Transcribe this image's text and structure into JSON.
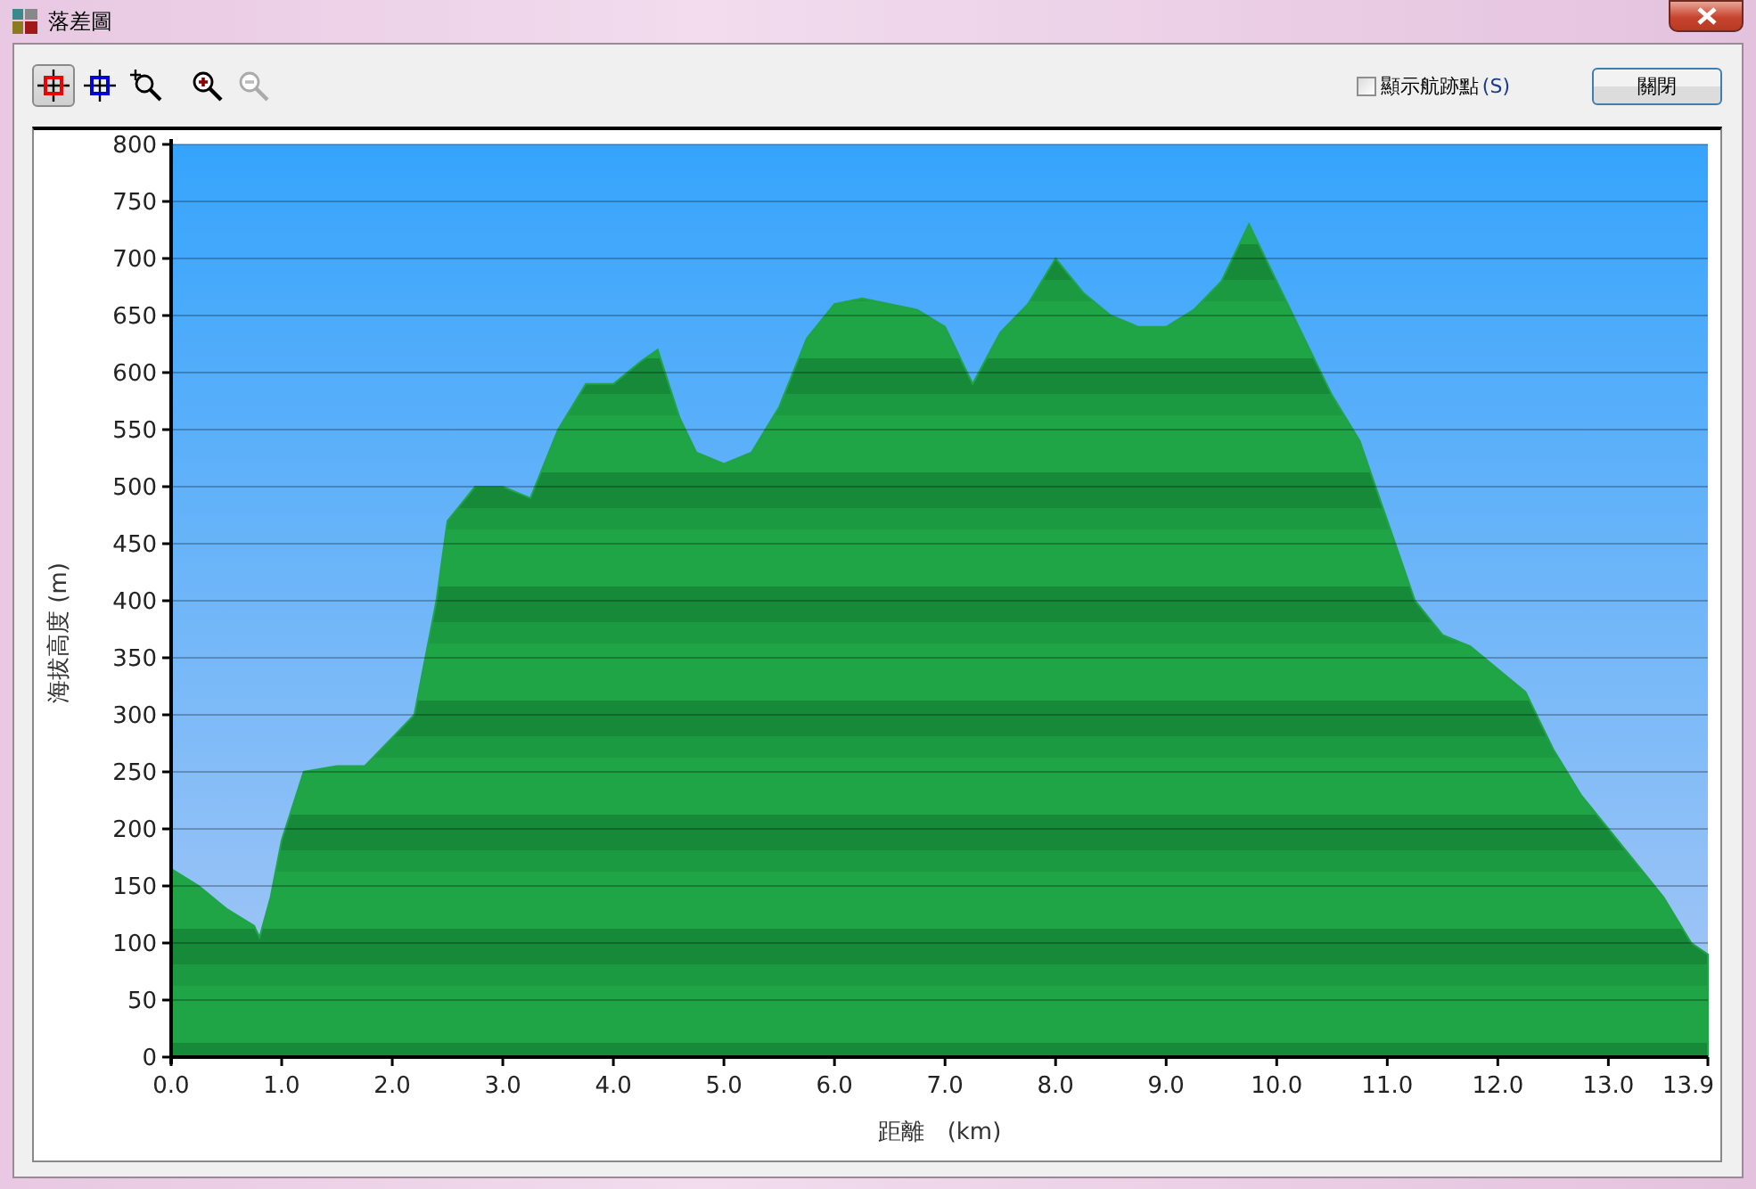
{
  "window": {
    "title": "落差圖"
  },
  "toolbar": {
    "tools": [
      {
        "kind": "marker",
        "selected": true,
        "disabled": false
      },
      {
        "kind": "point",
        "selected": false,
        "disabled": false
      },
      {
        "kind": "zoom-box",
        "selected": false,
        "disabled": false
      },
      {
        "kind": "zoom-in",
        "selected": false,
        "disabled": false
      },
      {
        "kind": "zoom-out",
        "selected": false,
        "disabled": true
      }
    ],
    "show_points": {
      "label": "顯示航跡點",
      "accel": "(S)",
      "checked": false
    },
    "close_button": "關閉"
  },
  "chart": {
    "chart_data": {
      "type": "area",
      "xlabel": "距離　(km)",
      "ylabel": "海拔高度 (m)",
      "x": [
        0,
        0.25,
        0.5,
        0.75,
        0.8,
        0.9,
        1.0,
        1.2,
        1.5,
        1.75,
        2.0,
        2.2,
        2.4,
        2.5,
        2.75,
        3.0,
        3.25,
        3.5,
        3.75,
        4.0,
        4.25,
        4.4,
        4.6,
        4.75,
        5.0,
        5.25,
        5.5,
        5.75,
        6.0,
        6.25,
        6.5,
        6.75,
        7.0,
        7.25,
        7.5,
        7.75,
        8.0,
        8.25,
        8.5,
        8.75,
        9.0,
        9.25,
        9.5,
        9.75,
        10.0,
        10.25,
        10.5,
        10.75,
        11.0,
        11.25,
        11.5,
        11.75,
        12.0,
        12.25,
        12.5,
        12.75,
        13.0,
        13.25,
        13.5,
        13.75,
        13.9
      ],
      "grid": true,
      "series": [
        {
          "color": "#1fa446",
          "values": [
            165,
            150,
            130,
            115,
            105,
            140,
            190,
            250,
            255,
            255,
            280,
            300,
            400,
            470,
            500,
            500,
            490,
            550,
            590,
            590,
            610,
            620,
            560,
            530,
            520,
            530,
            570,
            630,
            660,
            665,
            660,
            655,
            640,
            590,
            635,
            660,
            700,
            670,
            650,
            640,
            640,
            655,
            680,
            730,
            680,
            630,
            580,
            540,
            470,
            400,
            370,
            360,
            340,
            320,
            270,
            230,
            200,
            170,
            140,
            100,
            90
          ]
        }
      ],
      "xlim": [
        0,
        13.9
      ],
      "ylim": [
        0,
        800
      ],
      "xticks": [
        {
          "value": 0,
          "label": "0.0"
        },
        {
          "value": 1,
          "label": "1.0"
        },
        {
          "value": 2,
          "label": "2.0"
        },
        {
          "value": 3,
          "label": "3.0"
        },
        {
          "value": 4,
          "label": "4.0"
        },
        {
          "value": 5,
          "label": "5.0"
        },
        {
          "value": 6,
          "label": "6.0"
        },
        {
          "value": 7,
          "label": "7.0"
        },
        {
          "value": 8,
          "label": "8.0"
        },
        {
          "value": 9,
          "label": "9.0"
        },
        {
          "value": 10,
          "label": "10.0"
        },
        {
          "value": 11,
          "label": "11.0"
        },
        {
          "value": 12,
          "label": "12.0"
        },
        {
          "value": 13,
          "label": "13.0"
        },
        {
          "value": 13.9,
          "label": "13.9"
        }
      ],
      "yticks": [
        0,
        50,
        100,
        150,
        200,
        250,
        300,
        350,
        400,
        450,
        500,
        550,
        600,
        650,
        700,
        750,
        800
      ]
    }
  }
}
